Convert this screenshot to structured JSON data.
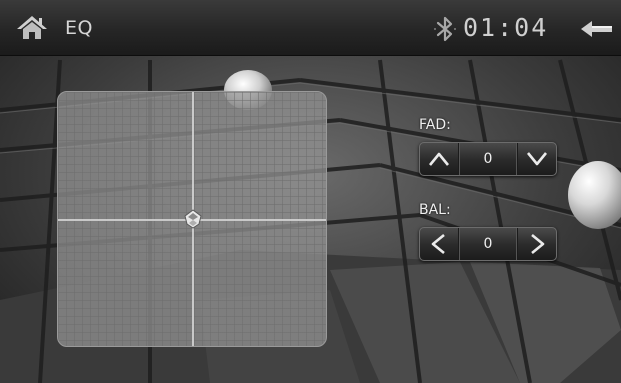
{
  "header": {
    "title": "EQ",
    "time": "01:04",
    "home_icon": "home-icon",
    "bluetooth_icon": "bluetooth-icon",
    "back_icon": "back-arrow-icon"
  },
  "eq_pad": {
    "fader_value": 0,
    "balance_value": 0,
    "marker_icon": "position-marker-icon"
  },
  "fader": {
    "label": "FAD:",
    "value": "0",
    "up_icon": "chevron-up-icon",
    "down_icon": "chevron-down-icon"
  },
  "balance": {
    "label": "BAL:",
    "value": "0",
    "left_icon": "chevron-left-icon",
    "right_icon": "chevron-right-icon"
  },
  "colors": {
    "top_bar": "#262626",
    "text": "#d6d6d6",
    "pad": "#969696"
  }
}
